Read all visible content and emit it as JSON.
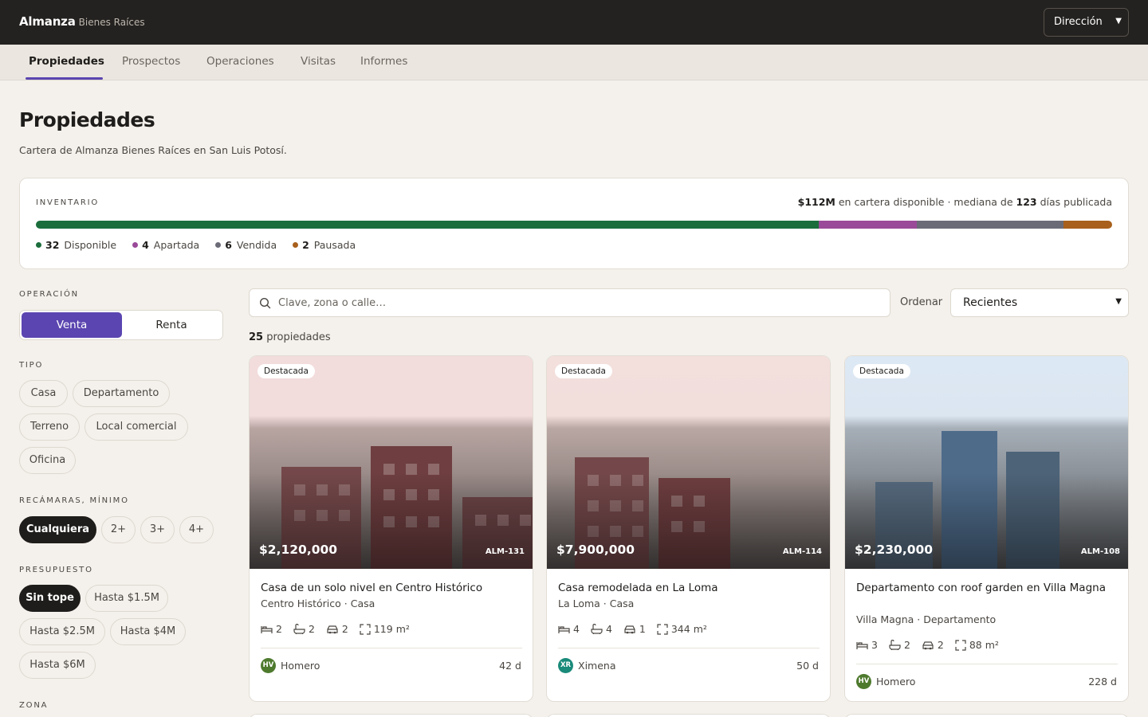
{
  "header": {
    "brand_name": "Almanza",
    "brand_sub": "Bienes Raíces",
    "role_select": "Dirección"
  },
  "tabs": [
    {
      "label": "Propiedades",
      "active": true
    },
    {
      "label": "Prospectos"
    },
    {
      "label": "Operaciones"
    },
    {
      "label": "Visitas"
    },
    {
      "label": "Informes"
    }
  ],
  "page": {
    "title": "Propiedades",
    "subtitle": "Cartera de Almanza Bienes Raíces en San Luis Potosí."
  },
  "inventory": {
    "label": "INVENTARIO",
    "summary_value": "$112M",
    "summary_mid": "en cartera disponible · mediana de",
    "summary_days": "123",
    "summary_end": "días publicada",
    "statuses": [
      {
        "count": "32",
        "label": "Disponible",
        "color": "#1b6e3c"
      },
      {
        "count": "4",
        "label": "Apartada",
        "color": "#9a4a98"
      },
      {
        "count": "6",
        "label": "Vendida",
        "color": "#6b6b78"
      },
      {
        "count": "2",
        "label": "Pausada",
        "color": "#a8601c"
      }
    ]
  },
  "filters": {
    "operation_label": "OPERACIÓN",
    "operation_options": [
      "Venta",
      "Renta"
    ],
    "type_label": "TIPO",
    "type_options": [
      "Casa",
      "Departamento",
      "Terreno",
      "Local comercial",
      "Oficina"
    ],
    "bedrooms_label": "RECÁMARAS, MÍNIMO",
    "bedrooms_options": [
      "Cualquiera",
      "2+",
      "3+",
      "4+"
    ],
    "budget_label": "PRESUPUESTO",
    "budget_options": [
      "Sin tope",
      "Hasta $1.5M",
      "Hasta $2.5M",
      "Hasta $4M",
      "Hasta $6M"
    ],
    "zone_label": "ZONA"
  },
  "search": {
    "placeholder": "Clave, zona o calle…",
    "sort_label": "Ordenar",
    "sort_value": "Recientes",
    "count_value": "25",
    "count_label": "propiedades"
  },
  "listings": [
    {
      "badge": "Destacada",
      "price": "$2,120,000",
      "code": "ALM-131",
      "title": "Casa de un solo nivel en Centro Histórico",
      "location": "Centro Histórico · Casa",
      "beds": "2",
      "baths": "2",
      "parking": "2",
      "area": "119 m²",
      "agent_initials": "HV",
      "agent_name": "Homero",
      "agent_color": "#4e7a2e",
      "days": "42 d"
    },
    {
      "badge": "Destacada",
      "price": "$7,900,000",
      "code": "ALM-114",
      "title": "Casa remodelada en La Loma",
      "location": "La Loma · Casa",
      "beds": "4",
      "baths": "4",
      "parking": "1",
      "area": "344 m²",
      "agent_initials": "XR",
      "agent_name": "Ximena",
      "agent_color": "#1a8a7a",
      "days": "50 d"
    },
    {
      "badge": "Destacada",
      "price": "$2,230,000",
      "code": "ALM-108",
      "title": "Departamento con roof garden en Villa Magna",
      "location": "Villa Magna · Departamento",
      "beds": "3",
      "baths": "2",
      "parking": "2",
      "area": "88 m²",
      "agent_initials": "HV",
      "agent_name": "Homero",
      "agent_color": "#4e7a2e",
      "days": "228 d"
    }
  ]
}
